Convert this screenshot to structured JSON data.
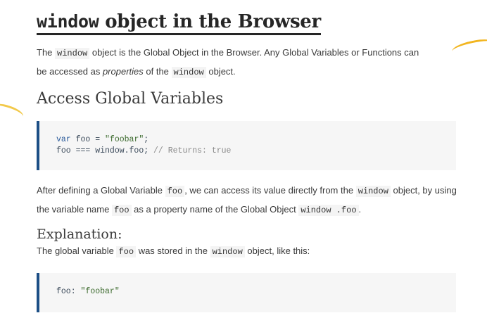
{
  "title": {
    "code_word": "window",
    "rest": " object in the Browser"
  },
  "intro": {
    "t1": "The ",
    "c1": "window",
    "t2": " object is the Global Object in the Browser. Any Global Variables or Functions can be accessed as ",
    "em": "properties",
    "t3": " of the ",
    "c2": "window",
    "t4": " object."
  },
  "section1": {
    "heading": "Access Global Variables"
  },
  "code1": {
    "line1": {
      "kw": "var",
      "mid": " foo = ",
      "str": "\"foobar\"",
      "end": ";"
    },
    "line2": {
      "code": "foo === window.foo; ",
      "comment": "// Returns: true"
    }
  },
  "after": {
    "t1": "After defining a Global Variable ",
    "c1": "foo",
    "t2": ", we can access its value directly from the ",
    "c2": "window",
    "t3": " object, by using the variable name ",
    "c3": "foo",
    "t4": " as a property name of the Global Object ",
    "c4": "window .foo",
    "t5": "."
  },
  "section2": {
    "heading": "Explanation:"
  },
  "explain": {
    "t1": "The global variable ",
    "c1": "foo",
    "t2": " was stored in the ",
    "c2": "window",
    "t3": " object, like this:"
  },
  "code2": {
    "key": "foo: ",
    "str": "\"foobar\""
  },
  "colors": {
    "accent_border": "#1d4f86",
    "code_background": "#f6f6f6",
    "streak": "#f2b51f"
  }
}
